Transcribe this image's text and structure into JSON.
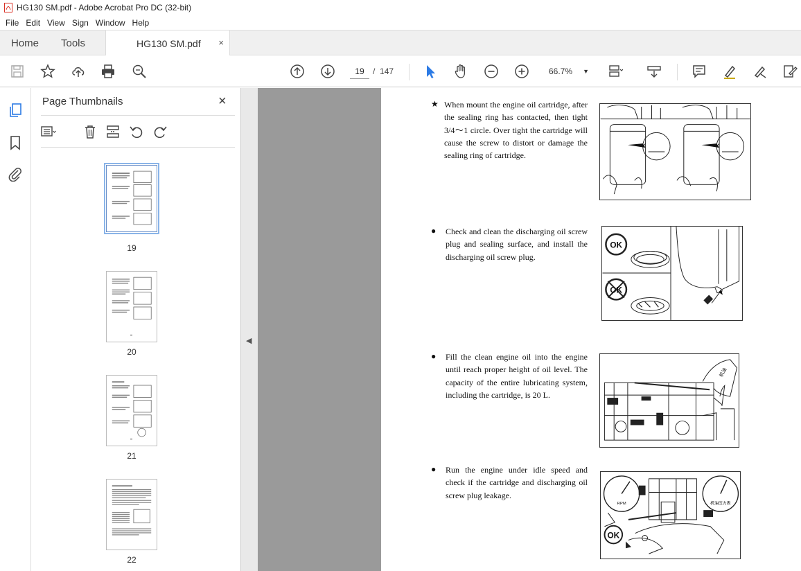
{
  "window": {
    "title": "HG130 SM.pdf - Adobe Acrobat Pro DC (32-bit)"
  },
  "menu": {
    "items": [
      "File",
      "Edit",
      "View",
      "Sign",
      "Window",
      "Help"
    ]
  },
  "tabs": {
    "home": "Home",
    "tools": "Tools",
    "doc": "HG130 SM.pdf",
    "close": "×"
  },
  "toolbar": {
    "page_current": "19",
    "page_separator": "/",
    "page_total": "147",
    "zoom": "66.7%"
  },
  "panel": {
    "title": "Page Thumbnails",
    "close": "×",
    "thumbnails": [
      {
        "label": "19",
        "selected": true
      },
      {
        "label": "20",
        "selected": false
      },
      {
        "label": "21",
        "selected": false
      },
      {
        "label": "22",
        "selected": false
      }
    ]
  },
  "page": {
    "items": [
      {
        "marker": "★",
        "text": "When mount the engine oil cartridge, after the sealing ring has contacted, then tight 3/4～1 circle. Over tight the cartridge will cause the screw to distort or damage the sealing ring of cartridge."
      },
      {
        "marker": "●",
        "text": "Check and clean the discharging oil screw plug and sealing surface, and install the discharging oil screw plug."
      },
      {
        "marker": "●",
        "text": "Fill the clean engine oil into the engine until reach proper height of oil level. The capacity of the entire lubricating system, including the cartridge, is 20 L."
      },
      {
        "marker": "●",
        "text": "Run the engine under idle speed and check if the cartridge and discharging oil screw plug leakage."
      }
    ],
    "fig_labels": {
      "ok": "OK",
      "gauge_left": "RPM",
      "gauge_right": "机油压力表",
      "oil_can": "机油"
    }
  },
  "colors": {
    "accent": "#2c7be5",
    "doc_bg": "#9a9a9a",
    "tab_bg": "#f0f0f0"
  }
}
